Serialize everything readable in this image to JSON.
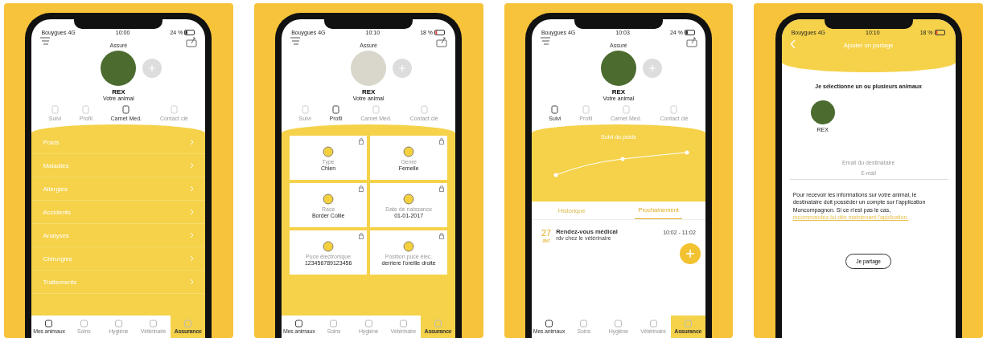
{
  "phones": [
    {
      "kind": "menu",
      "status": {
        "carrier": "Bouygues 4G",
        "time": "10:00",
        "battery": "24 %"
      },
      "header": {
        "title": "Assuré",
        "pet_name": "REX",
        "pet_subtitle": "Votre animal"
      },
      "tabs": [
        {
          "label": "Suivi",
          "selected": false
        },
        {
          "label": "Profil",
          "selected": false
        },
        {
          "label": "Carnet Med.",
          "selected": true
        },
        {
          "label": "Contact clé",
          "selected": false
        }
      ],
      "menu_items": [
        "Poids",
        "Maladies",
        "Allergies",
        "Accidents",
        "Analyses",
        "Chirurgies",
        "Traitements"
      ],
      "nav": [
        {
          "label": "Mes animaux",
          "selected": true,
          "highlighted": false
        },
        {
          "label": "Soins",
          "selected": false,
          "highlighted": false
        },
        {
          "label": "Hygiène",
          "selected": false,
          "highlighted": false
        },
        {
          "label": "Vétérinaire",
          "selected": false,
          "highlighted": false
        },
        {
          "label": "Assurance",
          "selected": false,
          "highlighted": true
        }
      ]
    },
    {
      "kind": "profile",
      "status": {
        "carrier": "Bouygues 4G",
        "time": "10:10",
        "battery": "18 %"
      },
      "header": {
        "title": "Assuré",
        "pet_name": "REX",
        "pet_subtitle": "Votre animal"
      },
      "tabs": [
        {
          "label": "Suivi",
          "selected": false
        },
        {
          "label": "Profil",
          "selected": true
        },
        {
          "label": "Carnet Med.",
          "selected": false
        },
        {
          "label": "Contact clé",
          "selected": false
        }
      ],
      "cards": [
        {
          "label": "Type",
          "value": "Chien"
        },
        {
          "label": "Genre",
          "value": "Femelle"
        },
        {
          "label": "Race",
          "value": "Border Collie"
        },
        {
          "label": "Date de naissance",
          "value": "01-01-2017"
        },
        {
          "label": "Puce électronique",
          "value": "123456789123456"
        },
        {
          "label": "Position puce élec.",
          "value": "derriere l'oreille droite"
        }
      ],
      "nav": [
        {
          "label": "Mes animaux",
          "selected": true,
          "highlighted": false
        },
        {
          "label": "Soins",
          "selected": false,
          "highlighted": false
        },
        {
          "label": "Hygiène",
          "selected": false,
          "highlighted": false
        },
        {
          "label": "Vétérinaire",
          "selected": false,
          "highlighted": false
        },
        {
          "label": "Assurance",
          "selected": false,
          "highlighted": true
        }
      ]
    },
    {
      "kind": "tracking",
      "status": {
        "carrier": "Bouygues 4G",
        "time": "10:03",
        "battery": "24 %"
      },
      "header": {
        "title": "Assuré",
        "pet_name": "REX",
        "pet_subtitle": "Votre animal"
      },
      "tabs": [
        {
          "label": "Suivi",
          "selected": true
        },
        {
          "label": "Profil",
          "selected": false
        },
        {
          "label": "Carnet Med.",
          "selected": false
        },
        {
          "label": "Contact clé",
          "selected": false
        }
      ],
      "chart_title": "Suivi du poids",
      "event_tabs": [
        {
          "label": "Historique",
          "selected": false
        },
        {
          "label": "Prochainement",
          "selected": true
        }
      ],
      "event": {
        "day": "27",
        "month": "avr",
        "title": "Rendez-vous médical",
        "subtitle": "rdv chez le vétérinaire",
        "time": "10:02 - 11:02"
      },
      "nav": [
        {
          "label": "Mes animaux",
          "selected": true,
          "highlighted": false
        },
        {
          "label": "Soins",
          "selected": false,
          "highlighted": false
        },
        {
          "label": "Hygiène",
          "selected": false,
          "highlighted": false
        },
        {
          "label": "Vétérinaire",
          "selected": false,
          "highlighted": false
        },
        {
          "label": "Assurance",
          "selected": false,
          "highlighted": true
        }
      ]
    },
    {
      "kind": "share",
      "status": {
        "carrier": "Bouygues 4G",
        "time": "10:10",
        "battery": "18 %"
      },
      "title": "Ajouter un partage",
      "prompt": "Je sélectionne un ou plusieurs animaux",
      "pet_name": "REX",
      "email_label": "Email du destinataire",
      "email_placeholder": "E-mail",
      "info": "Pour recevoir les informations sur votre  animal, le destinataire doit posséder un compte sur l'application Moncompagnon. Si ce n'est pas le cas,",
      "info_link": "recommandez-lui dès maintenant l'application.",
      "button": "Je partage"
    }
  ]
}
